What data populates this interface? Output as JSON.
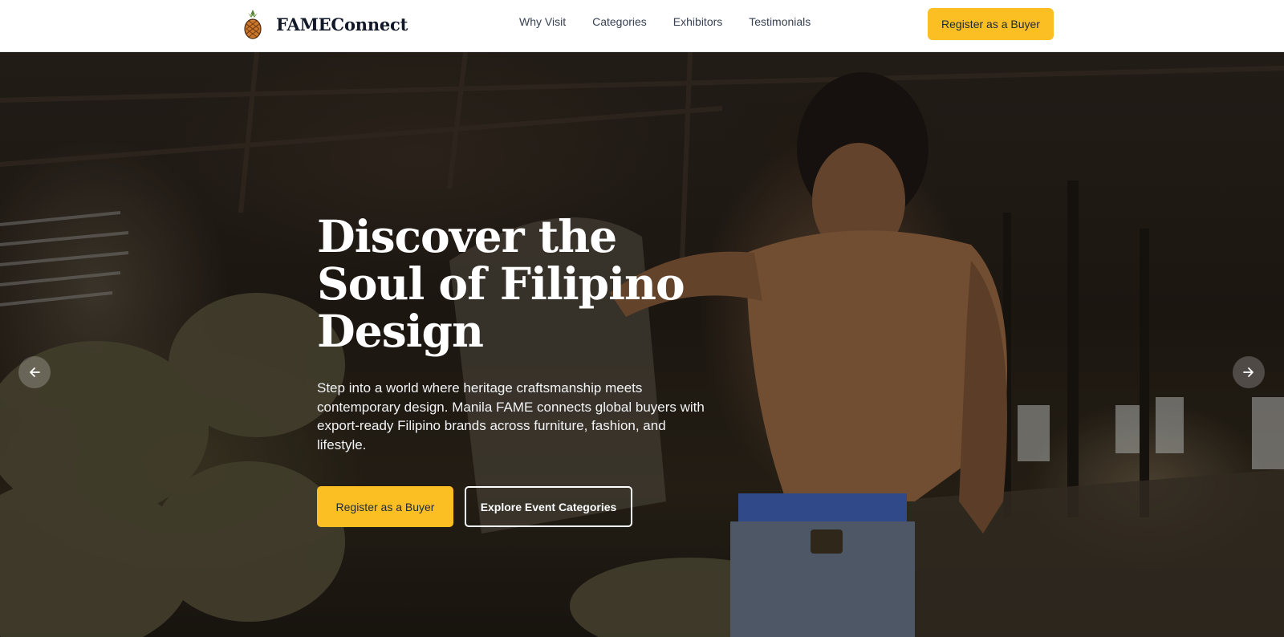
{
  "nav": {
    "brand_name": "FAMEConnect",
    "links": [
      "Why Visit",
      "Categories",
      "Exhibitors",
      "Testimonials"
    ],
    "cta_label": "Register as a Buyer"
  },
  "hero": {
    "title_lines": [
      "Discover the",
      "Soul of Filipino",
      "Design"
    ],
    "subtitle": "Step into a world where heritage craftsmanship meets contemporary design. Manila FAME connects global buyers with export-ready Filipino brands across furniture, fashion, and lifestyle.",
    "primary_cta": "Register as a Buyer",
    "secondary_cta": "Explore Event Categories",
    "prev_icon": "arrow-left-icon",
    "next_icon": "arrow-right-icon"
  },
  "colors": {
    "accent": "#fbbf24",
    "nav_bg": "#ffffff",
    "text_dark": "#1f2937"
  }
}
